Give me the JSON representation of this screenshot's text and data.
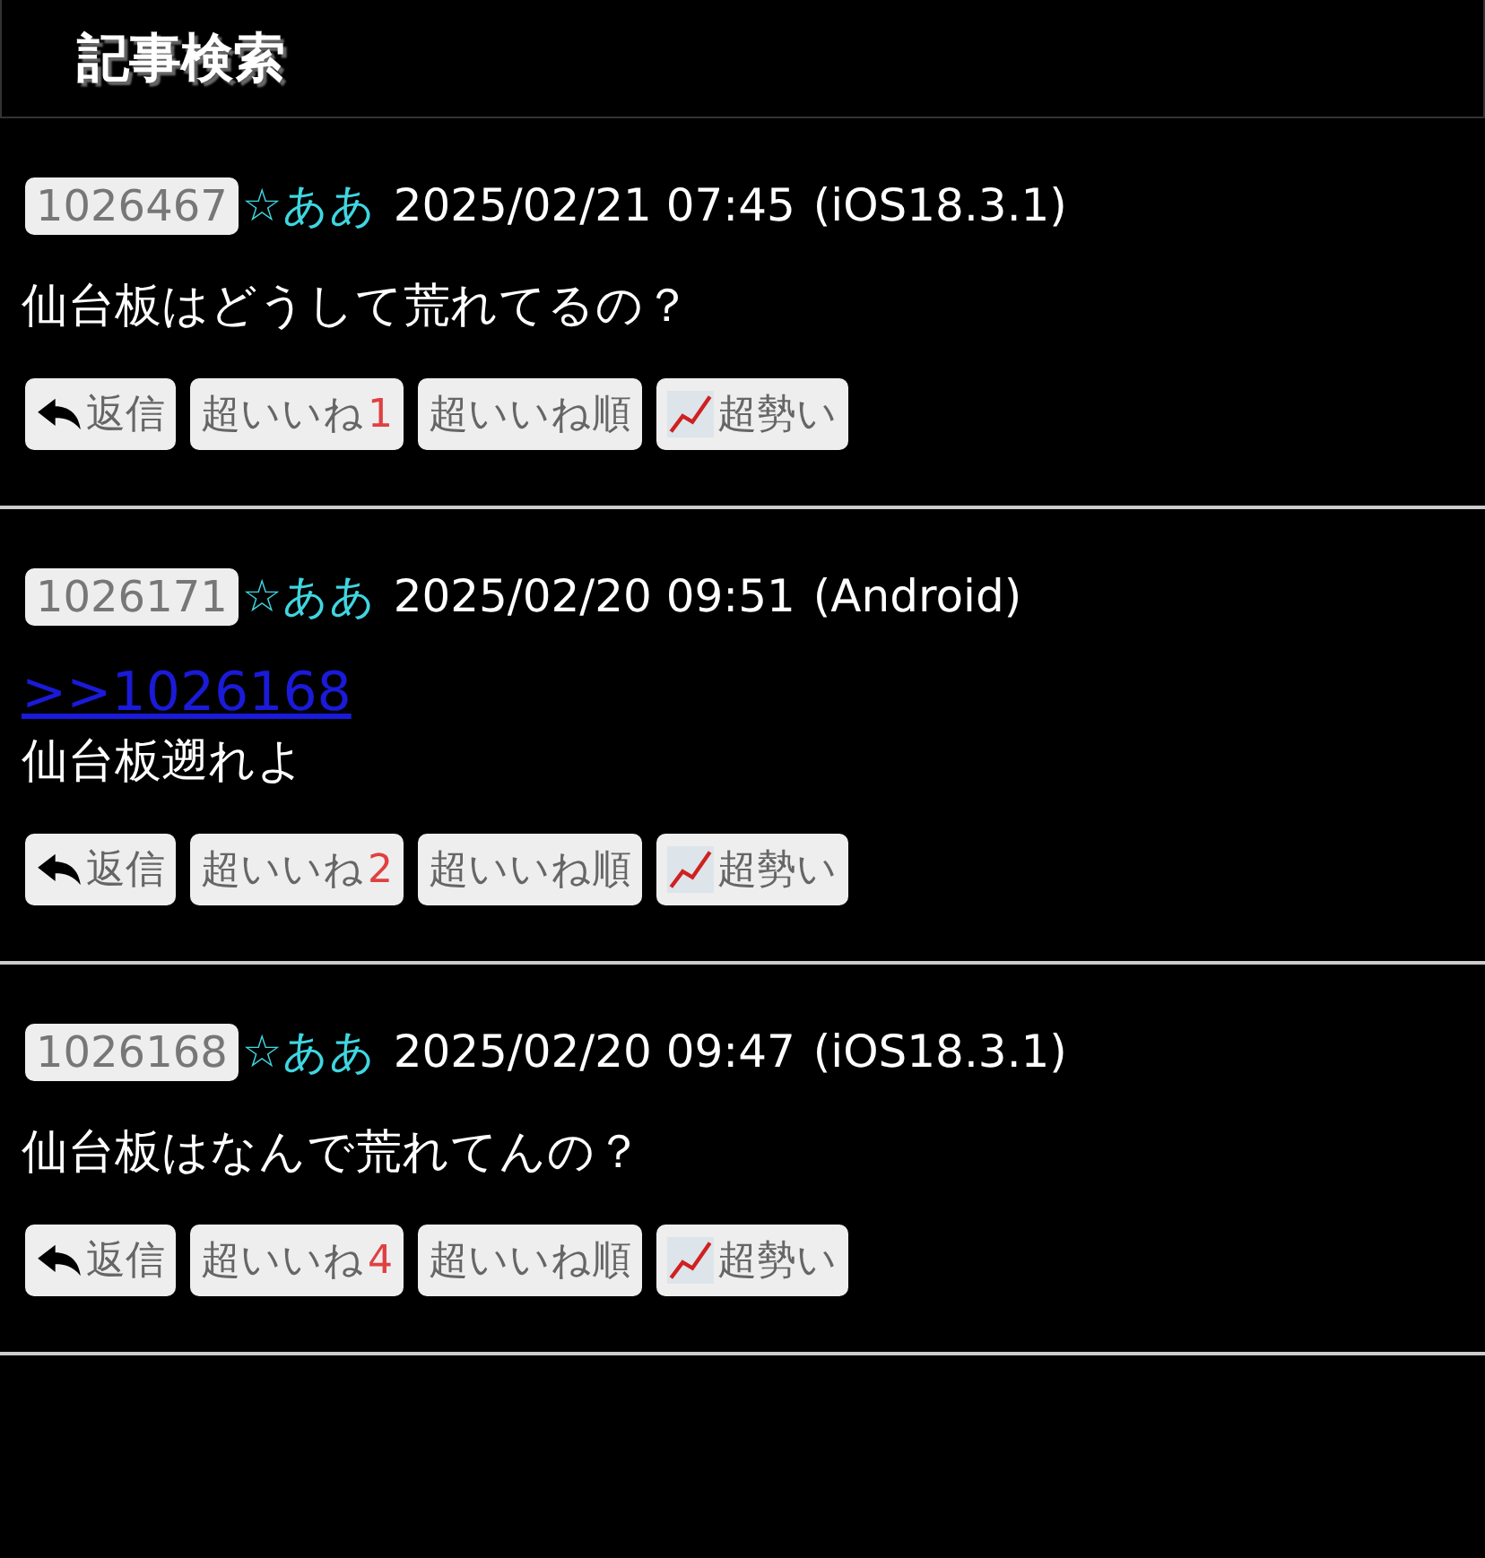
{
  "header": {
    "title": "記事検索"
  },
  "posts": [
    {
      "number": "1026467",
      "name": "☆ああ",
      "date": "2025/02/21 07:45",
      "device": "(iOS18.3.1)",
      "body": "仙台板はどうして荒れてるの？",
      "buttons": [
        {
          "kind": "reply",
          "label": "返信"
        },
        {
          "kind": "like",
          "label": "超いいね",
          "count": "1"
        },
        {
          "kind": "order",
          "label": "超いいね順"
        },
        {
          "kind": "trend",
          "label": "超勢い"
        }
      ]
    },
    {
      "number": "1026171",
      "name": "☆ああ",
      "date": "2025/02/20 09:51",
      "device": "(Android)",
      "quote": ">>1026168",
      "body": "仙台板遡れよ",
      "buttons": [
        {
          "kind": "reply",
          "label": "返信"
        },
        {
          "kind": "like",
          "label": "超いいね",
          "count": "2"
        },
        {
          "kind": "order",
          "label": "超いいね順"
        },
        {
          "kind": "trend",
          "label": "超勢い"
        }
      ]
    },
    {
      "number": "1026168",
      "name": "☆ああ",
      "date": "2025/02/20 09:47",
      "device": "(iOS18.3.1)",
      "body": "仙台板はなんで荒れてんの？",
      "buttons": [
        {
          "kind": "reply",
          "label": "返信"
        },
        {
          "kind": "like",
          "label": "超いいね",
          "count": "4"
        },
        {
          "kind": "order",
          "label": "超いいね順"
        },
        {
          "kind": "trend",
          "label": "超勢い"
        }
      ]
    }
  ]
}
